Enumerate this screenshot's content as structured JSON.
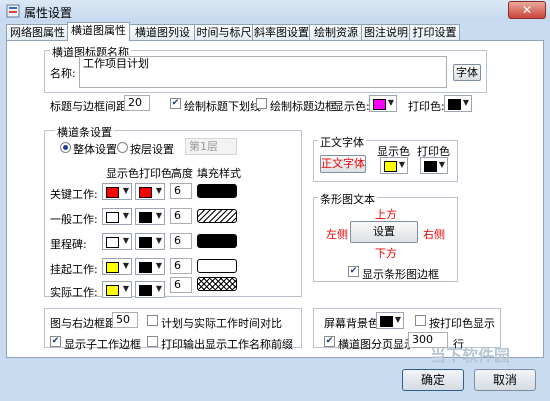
{
  "window": {
    "title": "属性设置",
    "close_label": "✕"
  },
  "tabs": [
    "网络图属性",
    "横道图属性",
    "横道图列设置",
    "时间与标尺",
    "斜率图设置",
    "绘制资源图",
    "图注说明",
    "打印设置"
  ],
  "title_group": {
    "legend": "横道图标题名称",
    "name_label": "名称:",
    "name_value": "工作项目计划",
    "font_button": "字体",
    "spacing_label": "标题与边框间距:",
    "spacing_value": "20",
    "underline_label": "绘制标题下划线",
    "border_label": "绘制标题边框",
    "display_color_label": "显示色:",
    "print_color_label": "打印色:",
    "display_color": "#ff00ff",
    "print_color": "#000000"
  },
  "bar_group": {
    "legend": "横道条设置",
    "overall_label": "整体设置",
    "layer_label": "按层设置",
    "layer_select": "第1层",
    "col_display": "显示色",
    "col_print": "打印色",
    "col_height": "高度",
    "col_fill": "填充样式",
    "rows": [
      {
        "label": "关键工作:",
        "display": "#ff0000",
        "print": "#ff0000",
        "height": "6",
        "fill": "solid"
      },
      {
        "label": "一般工作:",
        "display": "#ffffff",
        "print": "#000000",
        "height": "6",
        "fill": "hatch"
      },
      {
        "label": "里程碑:",
        "display": "#ffffff",
        "print": "#000000",
        "height": "6",
        "fill": "solid"
      },
      {
        "label": "挂起工作:",
        "display": "#ffff00",
        "print": "#000000",
        "height": "6",
        "fill": "empty"
      },
      {
        "label": "实际工作:",
        "display": "#ffff00",
        "print": "#000000",
        "height": "6",
        "fill": "cross"
      }
    ]
  },
  "text_font_group": {
    "legend": "正文字体",
    "font_button": "正文字体",
    "display_label": "显示色",
    "print_label": "打印色",
    "display_color": "#ffff00",
    "print_color": "#000000"
  },
  "bar_text_group": {
    "legend": "条形图文本",
    "top": "上方",
    "left": "左侧",
    "setting": "设置",
    "right": "右侧",
    "bottom": "下方",
    "show_label": "显示条形图边框"
  },
  "bottom": {
    "margin_label": "图与右边框距:",
    "margin_value": "50",
    "compare_label": "计划与实际工作时间对比",
    "sub_border_label": "显示子工作边框",
    "print_name_label": "打印输出显示工作名称前缀",
    "bg_label": "屏幕背景色",
    "bg_color": "#000000",
    "print_color_show_label": "按打印色显示",
    "page_label": "横道图分页显示",
    "page_value": "300",
    "page_unit": "行"
  },
  "buttons": {
    "ok": "确定",
    "cancel": "取消"
  },
  "watermark": "当下软件园"
}
